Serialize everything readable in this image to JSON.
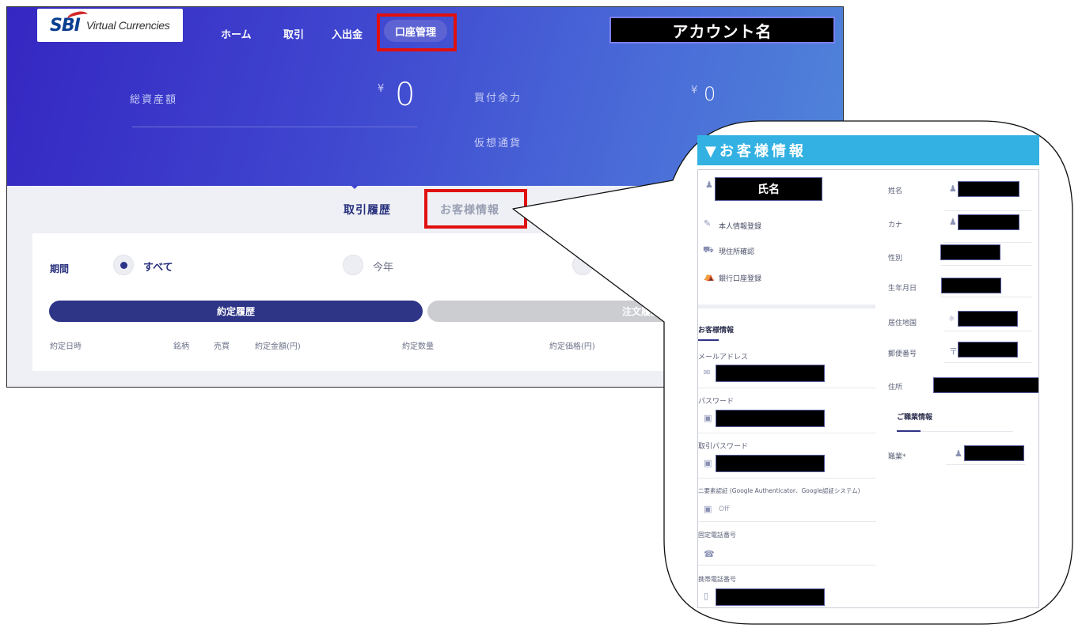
{
  "brand": {
    "logo_mark": "SBI",
    "logo_text": "Virtual Currencies"
  },
  "nav": {
    "items": [
      {
        "label": "ホーム"
      },
      {
        "label": "取引"
      },
      {
        "label": "入出金"
      },
      {
        "label": "口座管理",
        "active": true
      }
    ]
  },
  "account_name": "アカウント名",
  "summary": {
    "total_assets_label": "総資産額",
    "total_assets_currency": "¥",
    "total_assets_value": "0",
    "buying_power_label": "買付余力",
    "buying_power_currency": "¥",
    "buying_power_value": "0",
    "crypto_label": "仮想通貨"
  },
  "page_tabs": [
    {
      "label": "取引履歴",
      "active": true
    },
    {
      "label": "お客様情報",
      "active": false
    }
  ],
  "filter": {
    "period_label": "期間",
    "options": [
      {
        "label": "すべて",
        "selected": true
      },
      {
        "label": "今年",
        "selected": false
      }
    ]
  },
  "history_tabs": [
    {
      "label": "約定履歴",
      "active": true
    },
    {
      "label": "注文履歴",
      "active": false
    }
  ],
  "table_columns": [
    "約定日時",
    "銘柄",
    "売買",
    "約定金額(円)",
    "約定数量",
    "約定価格(円)"
  ],
  "callout": {
    "title": "▼お客様情報",
    "name_label": "氏名",
    "menu": [
      {
        "icon": "pencil-icon",
        "label": "本人情報登録"
      },
      {
        "icon": "truck-icon",
        "label": "現住所確認"
      },
      {
        "icon": "bank-icon",
        "label": "銀行口座登録"
      }
    ],
    "customer_section": "お客様情報",
    "fields": {
      "email": "メールアドレス",
      "password": "パスワード",
      "trade_password": "取引パスワード",
      "two_factor": "二要素認証 (Google Authenticator、Google認証システム)",
      "two_factor_value": "Off",
      "landline": "固定電話番号",
      "mobile": "携帯電話番号"
    },
    "personal": {
      "family_name": "姓名",
      "kana": "カナ",
      "gender": "性別",
      "birth_date": "生年月日",
      "country": "居住地国",
      "postal_code": "郵便番号",
      "postal_mark": "〒",
      "address": "住所"
    },
    "occupation_section": "ご職業情報",
    "occupation_label": "職業*"
  },
  "colors": {
    "hero_start": "#3527c2",
    "hero_end": "#4f84d9",
    "navy": "#2e3486",
    "highlight_red": "#e01010",
    "callout_blue": "#33b1e2"
  }
}
